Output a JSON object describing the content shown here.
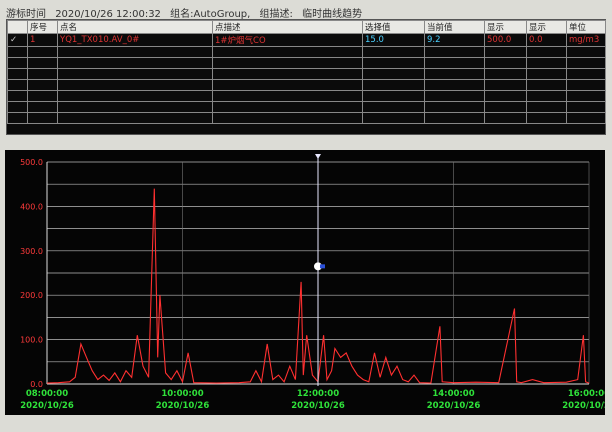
{
  "header": {
    "cursor_label": "游标时间",
    "cursor_time": "2020/10/26 12:00:32",
    "group_label": "组名:AutoGroup,",
    "desc_label": "组描述:",
    "desc_value": "临时曲线趋势"
  },
  "table": {
    "columns": [
      "",
      "序号",
      "点名",
      "点描述",
      "选择值",
      "当前值",
      "显示",
      "显示",
      "单位"
    ],
    "rows": [
      [
        "✓",
        "1",
        "YQ1_TX010.AV_0#",
        "1#炉烟气CO",
        "15.0",
        "9.2",
        "500.0",
        "0.0",
        "mg/m3"
      ]
    ]
  },
  "chart_data": {
    "type": "line",
    "title": "",
    "xlabel": "",
    "ylabel": "",
    "ylim": [
      0,
      500
    ],
    "x_range": [
      "2020/10/26 08:00:00",
      "2020/10/26 16:00:00"
    ],
    "y_ticks": [
      "0.0",
      "100.0",
      "200.0",
      "300.0",
      "400.0",
      "500.0"
    ],
    "x_ticks": [
      {
        "time": "08:00:00",
        "date": "2020/10/26"
      },
      {
        "time": "10:00:00",
        "date": "2020/10/26"
      },
      {
        "time": "12:00:00",
        "date": "2020/10/26"
      },
      {
        "time": "14:00:00",
        "date": "2020/10/26"
      },
      {
        "time": "16:00:00",
        "date": "2020/10/26"
      }
    ],
    "cursor_time": "12:00:32",
    "series": [
      {
        "name": "YQ1_TX010.AV_0#",
        "color": "#ff3030",
        "points": [
          [
            "08:00",
            2
          ],
          [
            "08:10",
            3
          ],
          [
            "08:20",
            5
          ],
          [
            "08:25",
            15
          ],
          [
            "08:30",
            90
          ],
          [
            "08:35",
            60
          ],
          [
            "08:40",
            30
          ],
          [
            "08:45",
            10
          ],
          [
            "08:50",
            20
          ],
          [
            "08:55",
            8
          ],
          [
            "09:00",
            25
          ],
          [
            "09:05",
            5
          ],
          [
            "09:10",
            30
          ],
          [
            "09:15",
            15
          ],
          [
            "09:20",
            110
          ],
          [
            "09:25",
            40
          ],
          [
            "09:30",
            15
          ],
          [
            "09:35",
            440
          ],
          [
            "09:38",
            60
          ],
          [
            "09:40",
            200
          ],
          [
            "09:45",
            25
          ],
          [
            "09:50",
            10
          ],
          [
            "09:55",
            30
          ],
          [
            "10:00",
            5
          ],
          [
            "10:05",
            70
          ],
          [
            "10:10",
            3
          ],
          [
            "10:30",
            2
          ],
          [
            "10:50",
            3
          ],
          [
            "11:00",
            5
          ],
          [
            "11:05",
            30
          ],
          [
            "11:10",
            5
          ],
          [
            "11:15",
            90
          ],
          [
            "11:20",
            10
          ],
          [
            "11:25",
            20
          ],
          [
            "11:30",
            5
          ],
          [
            "11:35",
            40
          ],
          [
            "11:40",
            10
          ],
          [
            "11:45",
            230
          ],
          [
            "11:47",
            20
          ],
          [
            "11:50",
            110
          ],
          [
            "11:55",
            20
          ],
          [
            "12:00",
            5
          ],
          [
            "12:05",
            110
          ],
          [
            "12:08",
            10
          ],
          [
            "12:12",
            30
          ],
          [
            "12:15",
            80
          ],
          [
            "12:20",
            60
          ],
          [
            "12:25",
            70
          ],
          [
            "12:30",
            40
          ],
          [
            "12:35",
            20
          ],
          [
            "12:40",
            10
          ],
          [
            "12:45",
            5
          ],
          [
            "12:50",
            70
          ],
          [
            "12:55",
            15
          ],
          [
            "13:00",
            60
          ],
          [
            "13:05",
            20
          ],
          [
            "13:10",
            40
          ],
          [
            "13:15",
            10
          ],
          [
            "13:20",
            5
          ],
          [
            "13:25",
            20
          ],
          [
            "13:30",
            3
          ],
          [
            "13:40",
            2
          ],
          [
            "13:48",
            130
          ],
          [
            "13:50",
            5
          ],
          [
            "14:00",
            3
          ],
          [
            "14:20",
            4
          ],
          [
            "14:40",
            3
          ],
          [
            "14:54",
            170
          ],
          [
            "14:56",
            5
          ],
          [
            "15:00",
            3
          ],
          [
            "15:10",
            10
          ],
          [
            "15:20",
            3
          ],
          [
            "15:40",
            4
          ],
          [
            "15:50",
            10
          ],
          [
            "15:55",
            110
          ],
          [
            "15:57",
            5
          ],
          [
            "16:00",
            2
          ]
        ]
      }
    ],
    "grid": true
  }
}
